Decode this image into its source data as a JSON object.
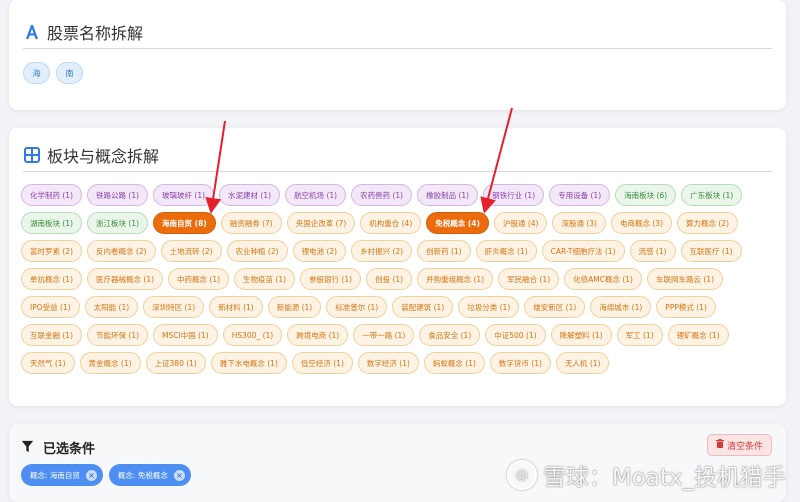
{
  "name_section": {
    "title": "股票名称拆解",
    "chips": [
      "海",
      "南"
    ]
  },
  "sector_section": {
    "title": "板块与概念拆解",
    "tags": [
      {
        "label": "化学制药 (1)",
        "style": "purple",
        "selected": false
      },
      {
        "label": "铁路公路 (1)",
        "style": "purple",
        "selected": false
      },
      {
        "label": "玻璃玻纤 (1)",
        "style": "purple",
        "selected": false
      },
      {
        "label": "水泥建材 (1)",
        "style": "purple",
        "selected": false
      },
      {
        "label": "航空机场 (1)",
        "style": "purple",
        "selected": false
      },
      {
        "label": "农药兽药 (1)",
        "style": "purple",
        "selected": false
      },
      {
        "label": "橡胶制品 (1)",
        "style": "purple",
        "selected": false
      },
      {
        "label": "钢铁行业 (1)",
        "style": "purple",
        "selected": false
      },
      {
        "label": "专用设备 (1)",
        "style": "purple",
        "selected": false
      },
      {
        "label": "海南板块 (6)",
        "style": "green",
        "selected": false
      },
      {
        "label": "广东板块 (1)",
        "style": "green",
        "selected": false
      },
      {
        "label": "湖南板块 (1)",
        "style": "green",
        "selected": false
      },
      {
        "label": "浙江板块 (1)",
        "style": "green",
        "selected": false
      },
      {
        "label": "海南自贸 (8)",
        "style": "orange",
        "selected": true
      },
      {
        "label": "融资融券 (7)",
        "style": "orange",
        "selected": false
      },
      {
        "label": "央国企改革 (7)",
        "style": "orange",
        "selected": false
      },
      {
        "label": "机构重仓 (4)",
        "style": "orange",
        "selected": false
      },
      {
        "label": "免税概念 (4)",
        "style": "orange",
        "selected": true
      },
      {
        "label": "沪股通 (4)",
        "style": "orange",
        "selected": false
      },
      {
        "label": "深股通 (3)",
        "style": "orange",
        "selected": false
      },
      {
        "label": "电商概念 (3)",
        "style": "orange",
        "selected": false
      },
      {
        "label": "算力概念 (2)",
        "style": "orange",
        "selected": false
      },
      {
        "label": "富时罗素 (2)",
        "style": "orange",
        "selected": false
      },
      {
        "label": "反内卷概念 (2)",
        "style": "orange",
        "selected": false
      },
      {
        "label": "土地流转 (2)",
        "style": "orange",
        "selected": false
      },
      {
        "label": "农业种植 (2)",
        "style": "orange",
        "selected": false
      },
      {
        "label": "锂电池 (2)",
        "style": "orange",
        "selected": false
      },
      {
        "label": "乡村振兴 (2)",
        "style": "orange",
        "selected": false
      },
      {
        "label": "创新药 (1)",
        "style": "orange",
        "selected": false
      },
      {
        "label": "肝炎概念 (1)",
        "style": "orange",
        "selected": false
      },
      {
        "label": "CAR-T细胞疗法 (1)",
        "style": "orange",
        "selected": false
      },
      {
        "label": "流感 (1)",
        "style": "orange",
        "selected": false
      },
      {
        "label": "互联医疗 (1)",
        "style": "orange",
        "selected": false
      },
      {
        "label": "单抗概念 (1)",
        "style": "orange",
        "selected": false
      },
      {
        "label": "医疗器械概念 (1)",
        "style": "orange",
        "selected": false
      },
      {
        "label": "中药概念 (1)",
        "style": "orange",
        "selected": false
      },
      {
        "label": "生物疫苗 (1)",
        "style": "orange",
        "selected": false
      },
      {
        "label": "参股银行 (1)",
        "style": "orange",
        "selected": false
      },
      {
        "label": "创投 (1)",
        "style": "orange",
        "selected": false
      },
      {
        "label": "并购重组概念 (1)",
        "style": "orange",
        "selected": false
      },
      {
        "label": "军民融合 (1)",
        "style": "orange",
        "selected": false
      },
      {
        "label": "化债AMC概念 (1)",
        "style": "orange",
        "selected": false
      },
      {
        "label": "车联网车路云 (1)",
        "style": "orange",
        "selected": false
      },
      {
        "label": "IPO受益 (1)",
        "style": "orange",
        "selected": false
      },
      {
        "label": "太阳能 (1)",
        "style": "orange",
        "selected": false
      },
      {
        "label": "深圳特区 (1)",
        "style": "orange",
        "selected": false
      },
      {
        "label": "新材料 (1)",
        "style": "orange",
        "selected": false
      },
      {
        "label": "新能源 (1)",
        "style": "orange",
        "selected": false
      },
      {
        "label": "标准普尔 (1)",
        "style": "orange",
        "selected": false
      },
      {
        "label": "装配建筑 (1)",
        "style": "orange",
        "selected": false
      },
      {
        "label": "垃圾分类 (1)",
        "style": "orange",
        "selected": false
      },
      {
        "label": "雄安新区 (1)",
        "style": "orange",
        "selected": false
      },
      {
        "label": "海绵城市 (1)",
        "style": "orange",
        "selected": false
      },
      {
        "label": "PPP模式 (1)",
        "style": "orange",
        "selected": false
      },
      {
        "label": "互联金融 (1)",
        "style": "orange",
        "selected": false
      },
      {
        "label": "节能环保 (1)",
        "style": "orange",
        "selected": false
      },
      {
        "label": "MSCI中国 (1)",
        "style": "orange",
        "selected": false
      },
      {
        "label": "HS300_ (1)",
        "style": "orange",
        "selected": false
      },
      {
        "label": "跨境电商 (1)",
        "style": "orange",
        "selected": false
      },
      {
        "label": "一带一路 (1)",
        "style": "orange",
        "selected": false
      },
      {
        "label": "食品安全 (1)",
        "style": "orange",
        "selected": false
      },
      {
        "label": "中证500 (1)",
        "style": "orange",
        "selected": false
      },
      {
        "label": "降解塑料 (1)",
        "style": "orange",
        "selected": false
      },
      {
        "label": "军工 (1)",
        "style": "orange",
        "selected": false
      },
      {
        "label": "锂矿概念 (1)",
        "style": "orange",
        "selected": false
      },
      {
        "label": "天然气 (1)",
        "style": "orange",
        "selected": false
      },
      {
        "label": "黄金概念 (1)",
        "style": "orange",
        "selected": false
      },
      {
        "label": "上证380 (1)",
        "style": "orange",
        "selected": false
      },
      {
        "label": "雅下水电概念 (1)",
        "style": "orange",
        "selected": false
      },
      {
        "label": "低空经济 (1)",
        "style": "orange",
        "selected": false
      },
      {
        "label": "数字经济 (1)",
        "style": "orange",
        "selected": false
      },
      {
        "label": "蚂蚁概念 (1)",
        "style": "orange",
        "selected": false
      },
      {
        "label": "数字货币 (1)",
        "style": "orange",
        "selected": false
      },
      {
        "label": "无人机 (1)",
        "style": "orange",
        "selected": false
      }
    ]
  },
  "filter_section": {
    "title": "已选条件",
    "clear_label": "清空条件",
    "selected": [
      "概念: 海南自贸",
      "概念: 免税概念"
    ]
  },
  "watermark": {
    "logo": "◎",
    "text": "雪球：Moatx_投机猎手"
  },
  "colors": {
    "selected_tag": "#ec6b0d",
    "industry_tag": "#8a3fae",
    "region_tag": "#3a8a3a",
    "concept_tag": "#d57512",
    "chip_blue": "#4d8ef2",
    "arrow_red": "#e5202a"
  },
  "icons": {
    "name_title": "font-a-icon",
    "sector_title": "grid-icon",
    "filter_title": "filter-icon",
    "clear": "trash-icon",
    "chip_remove": "close-icon"
  }
}
